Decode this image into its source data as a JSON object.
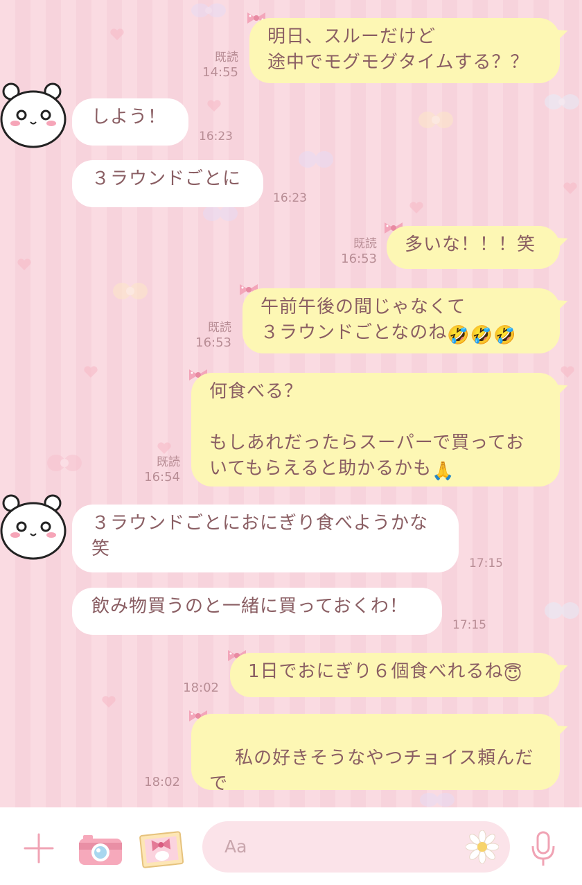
{
  "messages": [
    {
      "dir": "out",
      "text": "明日、スルーだけど\n途中でモグモグタイムする？？",
      "read": "既読",
      "time": "14:55"
    },
    {
      "dir": "in",
      "text": "しよう！",
      "time": "16:23"
    },
    {
      "dir": "in",
      "text": "３ラウンドごとに",
      "time": "16:23"
    },
    {
      "dir": "out",
      "text": "多いな！！！笑",
      "read": "既読",
      "time": "16:53"
    },
    {
      "dir": "out",
      "text": "午前午後の間じゃなくて\n３ラウンドごとなのね",
      "emoji_suffix": "🤣🤣🤣",
      "read": "既読",
      "time": "16:53"
    },
    {
      "dir": "out",
      "text": "何食べる？\n\nもしあれだったらスーパーで買ってお\nいてもらえると助かるかも",
      "emoji_suffix": "🙏",
      "read": "既読",
      "time": "16:54"
    },
    {
      "dir": "in",
      "text": "３ラウンドごとにおにぎり食べようかな\n笑",
      "time": "17:15"
    },
    {
      "dir": "in",
      "text": "飲み物買うのと一緒に買っておくわ！",
      "time": "17:15"
    },
    {
      "dir": "out",
      "text": "1日でおにぎり６個食べれるね",
      "emoji_suffix": "😇",
      "time": "18:02"
    },
    {
      "dir": "out",
      "text": "私の好きそうなやつチョイス頼んだで",
      "sticker": "bear-face-icon",
      "time": "18:02"
    }
  ],
  "input": {
    "placeholder": "Aa"
  },
  "icons": {
    "add": "plus-icon",
    "camera": "camera-icon",
    "photo": "photo-icon",
    "sticker": "daisy-sticker-icon",
    "mic": "microphone-icon"
  },
  "colors": {
    "out_bubble": "#fdf7b4",
    "in_bubble": "#ffffff",
    "text": "#8a5e63",
    "accent": "#f0a3b4"
  }
}
